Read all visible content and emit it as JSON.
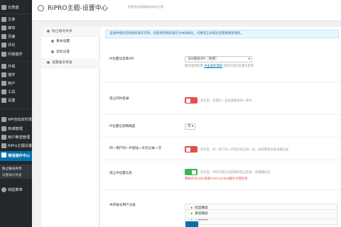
{
  "sidebar": {
    "items": [
      {
        "label": "仪表盘",
        "icon": "dashboard-icon"
      },
      {
        "label": "文章",
        "icon": "pin-icon"
      },
      {
        "label": "媒体",
        "icon": "media-icon"
      },
      {
        "label": "页面",
        "icon": "page-icon"
      },
      {
        "label": "评论",
        "icon": "comment-icon"
      },
      {
        "label": "问答插件",
        "icon": "question-icon"
      },
      {
        "label": "外观",
        "icon": "brush-icon"
      },
      {
        "label": "插件",
        "icon": "plugin-icon"
      },
      {
        "label": "用户",
        "icon": "users-icon"
      },
      {
        "label": "工具",
        "icon": "wrench-icon"
      },
      {
        "label": "设置",
        "icon": "settings-icon"
      },
      {
        "label": "WP自动定时发布",
        "icon": "clock-icon"
      },
      {
        "label": "商城管理",
        "icon": "cart-icon"
      },
      {
        "label": "用户推送管理",
        "icon": "bell-icon"
      },
      {
        "label": "RiPro主题设置",
        "icon": "theme-icon"
      },
      {
        "label": "增强插件中心",
        "icon": "gear-icon"
      }
    ],
    "submenu": [
      "防止账号共享",
      "设置备份恢复"
    ],
    "collapse_label": "收起菜单"
  },
  "header": {
    "title": "RiPRO主题-设置中心",
    "tagline": "您使用的是最新版本的主题"
  },
  "left_nav": {
    "group_label": "防止账号共享",
    "items": [
      "基本设置",
      "其他设置",
      "设置备份恢复"
    ]
  },
  "notice": "该插件授权仅限授权域名可用。您使用的授权域名为本地域名。切换到正式域名后需要重新授权。",
  "settings": {
    "api_label": "IP位置信息库API",
    "api_value": "360搜索API（免费）",
    "api_hint_pre": "推荐使用免费",
    "api_hint_link": "点击此处测试",
    "api_hint_post": "选择合适的位置信息库",
    "login_label": "禁止同时登录",
    "login_hint": "开启后，仅能在一台设备登录同一账号",
    "precision_label": "IP位置信息精确度",
    "precision_value": "市",
    "limit_label": "同一用户同一IP登陆一天仅记录一次",
    "limit_hint": "开启后，同一用户同一IP每天仅记录一次，关闭则每次登录都记录",
    "banip_label": "禁止IP位置信息",
    "banip_hint": "开启后，IP所在地无法获取时禁止登录，请谨慎开启",
    "banip_warn": "需要开启redis或者memcached缓存才能生效",
    "share_label": "共享账号用户分类",
    "share_items": [
      "轻度嫌疑",
      "中度嫌疑",
      "重度嫌疑"
    ]
  },
  "colors": {
    "sidebar_bg": "#23282d",
    "accent": "#0073aa",
    "toggle_off": "#e34e4e",
    "toggle_on": "#3fb34f"
  }
}
